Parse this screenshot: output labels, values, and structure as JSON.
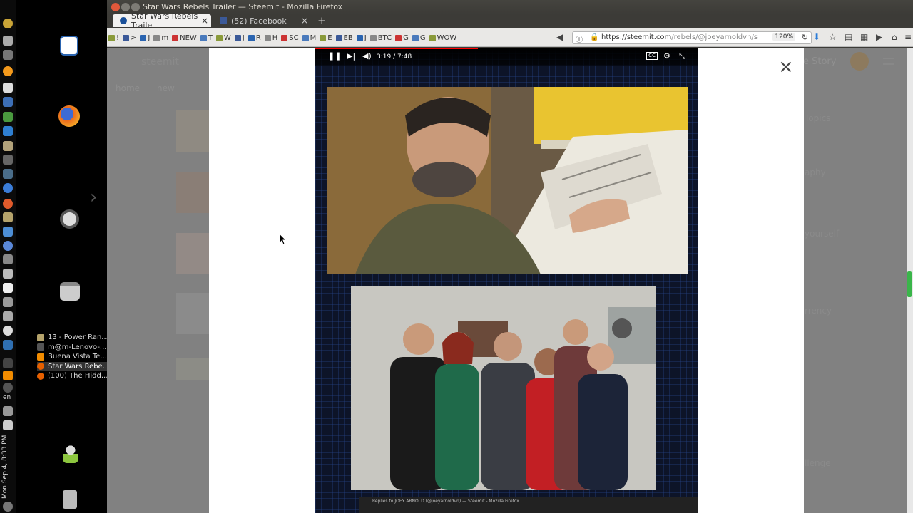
{
  "window": {
    "title": "Star Wars Rebels Trailer — Steemit - Mozilla Firefox"
  },
  "tabs": [
    {
      "label": "Star Wars Rebels Traile",
      "active": true,
      "favicon": "steemit-icon"
    },
    {
      "label": "(52) Facebook",
      "active": false,
      "favicon": "facebook-icon"
    }
  ],
  "new_tab_label": "+",
  "bookmarks": [
    "!",
    ">",
    "J",
    "m",
    "NEW",
    "T",
    "W",
    "J",
    "R",
    "H",
    "SC",
    "M",
    "E",
    "EB",
    "J",
    "BTC",
    "G",
    "G",
    "WOW"
  ],
  "address_bar": {
    "url_host": "https://steemit.com",
    "url_path": "/rebels/@joeyarnoldvn/s",
    "zoom": "120%"
  },
  "system": {
    "clock": "Mon Sep 4, 8:33 PM",
    "language": "en"
  },
  "window_list": [
    {
      "label": "13 - Power Ran..."
    },
    {
      "label": "m@m-Lenovo-..."
    },
    {
      "label": "Buena Vista Te..."
    },
    {
      "label": "Star Wars Rebe...",
      "active": true
    },
    {
      "label": "(100) The Hidd..."
    }
  ],
  "steemit_bg": {
    "logo": "steemit",
    "nav_new": "new",
    "nav_home": "home",
    "right_story": "e Story",
    "right_items": [
      "Topics",
      "aphy",
      "yourself",
      "rrency",
      "llenge"
    ]
  },
  "video": {
    "time": "3:19 / 7:48",
    "progress_fraction": 0.425,
    "thumbnail_caption": "Replies to JOEY ARNOLD (@joeyarnoldvn) — Steemit - Mozilla Firefox"
  },
  "modal": {
    "close_label": "×"
  },
  "colors": {
    "accent_green": "#3ab54a",
    "progress_red": "#ff0000",
    "video_blue": "#0d1428"
  }
}
